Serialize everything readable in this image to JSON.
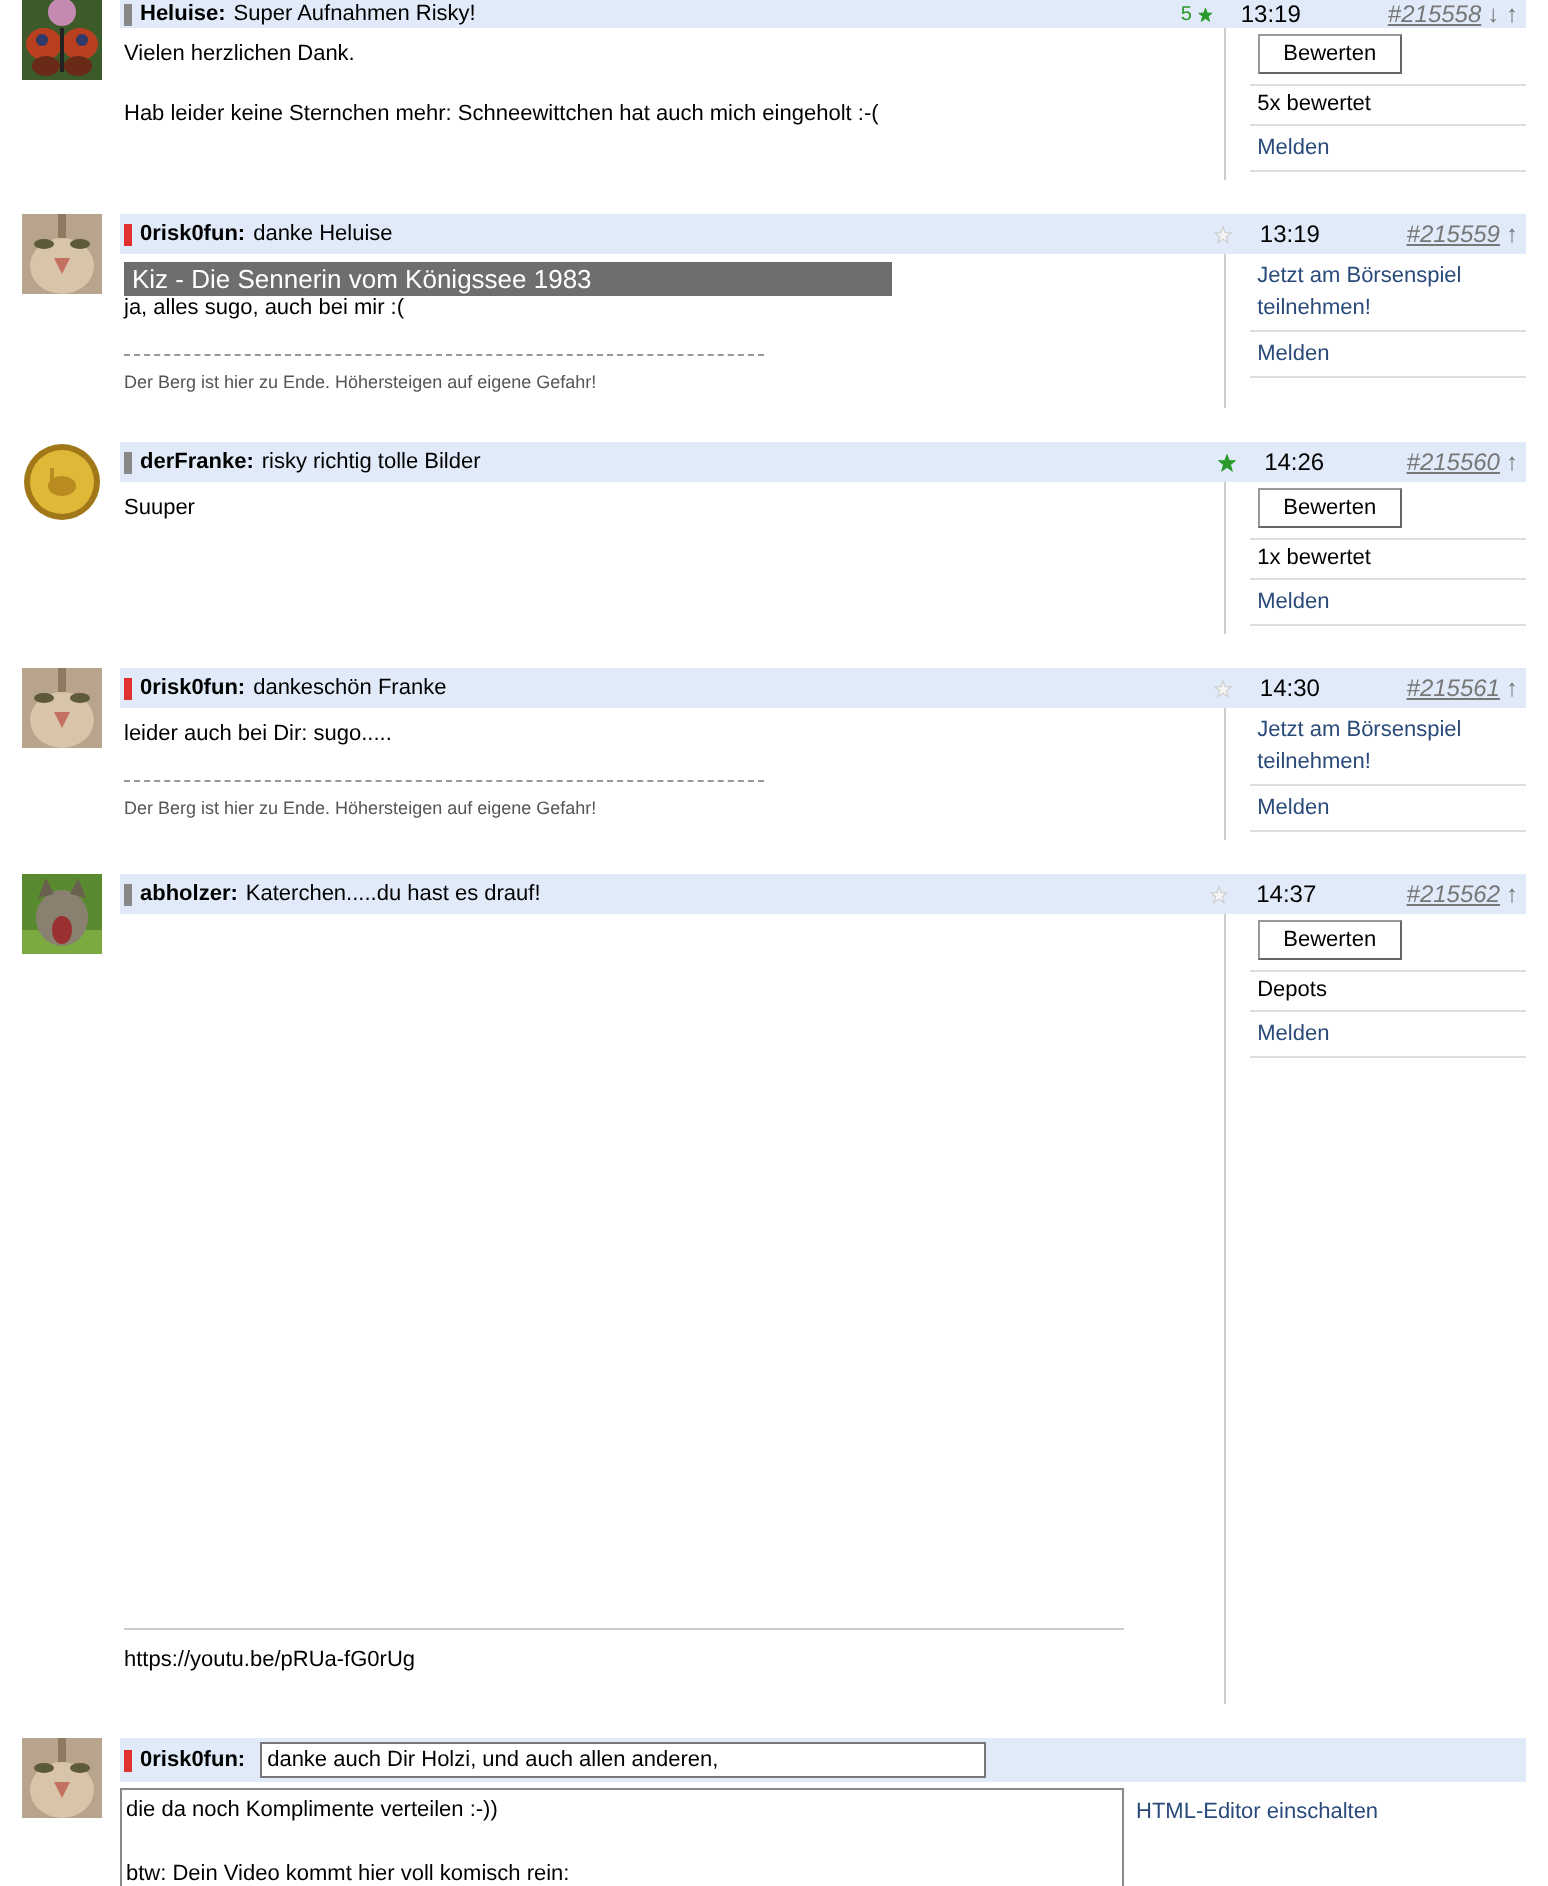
{
  "posts": [
    {
      "color": "#888888",
      "author": "Heluise:",
      "title": "Super Aufnahmen Risky!",
      "rating_count": "5",
      "rated": true,
      "time": "13:19",
      "number": "#215558",
      "arrows": "↓ ↑",
      "paragraphs": [
        "Vielen herzlichen Dank.",
        "Hab leider keine Sternchen mehr: Schneewittchen hat auch mich eingeholt :-("
      ],
      "side": [
        {
          "kind": "button",
          "text": "Bewerten"
        },
        {
          "kind": "text",
          "text": "5x bewertet"
        },
        {
          "kind": "link",
          "text": "Melden"
        }
      ]
    },
    {
      "color": "#e03030",
      "author": "0risk0fun:",
      "title": "danke Heluise",
      "rated": false,
      "time": "13:19",
      "number": "#215559",
      "arrows": "↑",
      "paragraphs": [
        "ja, alles sugo, auch bei mir :("
      ],
      "signature": "Der Berg ist hier zu Ende. Höhersteigen auf eigene Gefahr!",
      "side": [
        {
          "kind": "link",
          "text": "Jetzt am Börsenspiel teilnehmen!"
        },
        {
          "kind": "link",
          "text": "Melden"
        }
      ]
    },
    {
      "color": "#888888",
      "author": "derFranke:",
      "title": "risky richtig tolle Bilder",
      "rated": true,
      "time": "14:26",
      "number": "#215560",
      "arrows": "↑",
      "paragraphs": [
        "Suuper"
      ],
      "side": [
        {
          "kind": "button",
          "text": "Bewerten"
        },
        {
          "kind": "text",
          "text": "1x bewertet"
        },
        {
          "kind": "link",
          "text": "Melden"
        }
      ]
    },
    {
      "color": "#e03030",
      "author": "0risk0fun:",
      "title": "dankeschön Franke",
      "rated": false,
      "time": "14:30",
      "number": "#215561",
      "arrows": "↑",
      "paragraphs": [
        "leider auch bei Dir: sugo....."
      ],
      "signature": "Der Berg ist hier zu Ende. Höhersteigen auf eigene Gefahr!",
      "side": [
        {
          "kind": "link",
          "text": "Jetzt am Börsenspiel teilnehmen!"
        },
        {
          "kind": "link",
          "text": "Melden"
        }
      ]
    },
    {
      "color": "#888888",
      "author": "abholzer:",
      "title": "Katerchen.....du hast es drauf!",
      "rated": false,
      "time": "14:37",
      "number": "#215562",
      "arrows": "↑",
      "video": {
        "url": "https://youtu.be/pRUa-fG0rUg"
      },
      "side": [
        {
          "kind": "button",
          "text": "Bewerten"
        },
        {
          "kind": "text",
          "text": "Depots"
        },
        {
          "kind": "link",
          "text": "Melden"
        }
      ]
    }
  ],
  "video_overlay": {
    "title": "Kiz - Die Sennerin vom Königssee 1983"
  },
  "compose": {
    "color": "#e03030",
    "author": "0risk0fun:",
    "title_value": "danke auch Dir Holzi, und auch allen anderen,",
    "body_value": "die da noch Komplimente verteilen :-))\n\nbtw: Dein Video kommt hier voll komisch rein:",
    "editor_link": "HTML-Editor einschalten"
  }
}
